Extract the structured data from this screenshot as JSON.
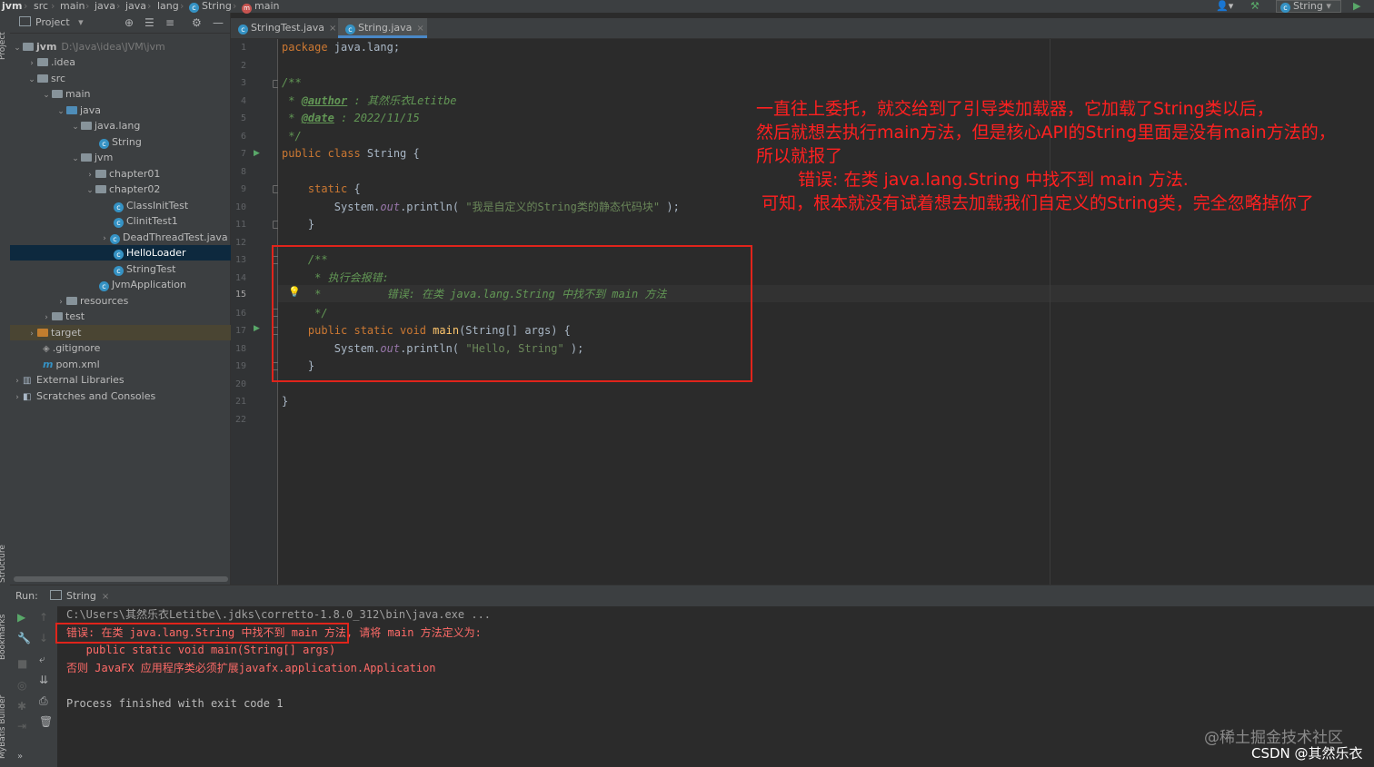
{
  "breadcrumb": [
    "jvm",
    "src",
    "main",
    "java",
    "lang",
    "String",
    "main"
  ],
  "toolbar": {
    "run_config": "String"
  },
  "side_labels": {
    "project": "Project",
    "structure": "Structure",
    "bookmarks": "Bookmarks",
    "mybatis": "MyBatis Builder"
  },
  "project_panel": {
    "title": "Project",
    "tree": [
      {
        "label": "jvm",
        "extra": "D:\\Java\\idea\\JVM\\jvm"
      },
      {
        "label": ".idea"
      },
      {
        "label": "src"
      },
      {
        "label": "main"
      },
      {
        "label": "java"
      },
      {
        "label": "java.lang"
      },
      {
        "label": "String"
      },
      {
        "label": "jvm"
      },
      {
        "label": "chapter01"
      },
      {
        "label": "chapter02"
      },
      {
        "label": "ClassInitTest"
      },
      {
        "label": "ClinitTest1"
      },
      {
        "label": "DeadThreadTest.java"
      },
      {
        "label": "HelloLoader"
      },
      {
        "label": "StringTest"
      },
      {
        "label": "JvmApplication"
      },
      {
        "label": "resources"
      },
      {
        "label": "test"
      },
      {
        "label": "target"
      },
      {
        "label": ".gitignore"
      },
      {
        "label": "pom.xml"
      },
      {
        "label": "External Libraries"
      },
      {
        "label": "Scratches and Consoles"
      }
    ]
  },
  "tabs": [
    {
      "label": "StringTest.java"
    },
    {
      "label": "String.java"
    }
  ],
  "editor": {
    "line_numbers": [
      "1",
      "2",
      "3",
      "4",
      "5",
      "6",
      "7",
      "8",
      "9",
      "10",
      "11",
      "12",
      "13",
      "14",
      "15",
      "16",
      "17",
      "18",
      "19",
      "20",
      "21",
      "22"
    ],
    "current_line": "15",
    "lines": {
      "l1_kw": "package",
      "l1_rest": " java.lang;",
      "l3": "/**",
      "l4_pre": " * ",
      "l4_tag": "@author",
      "l4_rest": " : 其然乐衣Letitbe",
      "l5_pre": " * ",
      "l5_tag": "@date",
      "l5_rest": " : 2022/11/15",
      "l6": " */",
      "l7_kw": "public class",
      "l7_rest": " String {",
      "l9_kw": "    static",
      "l9_rest": " {",
      "l10_a": "        System.",
      "l10_fld": "out",
      "l10_b": ".println( ",
      "l10_str": "\"我是自定义的String类的静态代码块\"",
      "l10_c": " );",
      "l11": "    }",
      "l13": "    /**",
      "l14": "     * 执行会报错:",
      "l15": "     *          错误: 在类 java.lang.String 中找不到 main 方法",
      "l16": "     */",
      "l17_kw": "    public static void ",
      "l17_fn": "main",
      "l17_rest": "(String[] args) {",
      "l18_a": "        System.",
      "l18_fld": "out",
      "l18_b": ".println( ",
      "l18_str": "\"Hello, String\"",
      "l18_c": " );",
      "l19": "    }",
      "l21": "}"
    }
  },
  "annotation": [
    "一直往上委托，就交给到了引导类加载器，它加载了String类以后，",
    "然后就想去执行main方法，但是核心API的String里面是没有main方法的，",
    "所以就报了",
    "错误: 在类 java.lang.String 中找不到 main 方法.",
    "可知，根本就没有试着想去加载我们自定义的String类，完全忽略掉你了"
  ],
  "run_panel": {
    "label": "Run:",
    "tab": "String",
    "lines": [
      "C:\\Users\\其然乐衣Letitbe\\.jdks\\corretto-1.8.0_312\\bin\\java.exe ...",
      "错误: 在类 java.lang.String 中找不到 main 方法,",
      " 请将 main 方法定义为:",
      "   public static void main(String[] args)",
      "否则 JavaFX 应用程序类必须扩展javafx.application.Application",
      "Process finished with exit code 1"
    ]
  },
  "watermark": {
    "line1": "@稀土掘金技术社区",
    "line2": "CSDN @其然乐衣"
  },
  "colors": {
    "accent": "#4a88c7",
    "annotation": "#ff2020",
    "error": "#ff6b68"
  }
}
